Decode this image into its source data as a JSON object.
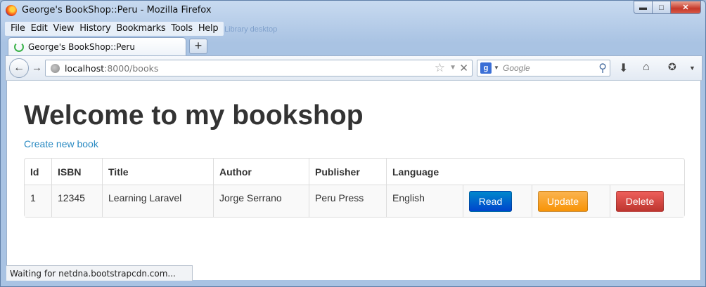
{
  "window": {
    "title": "George's BookShop::Peru - Mozilla Firefox"
  },
  "menu": [
    "File",
    "Edit",
    "View",
    "History",
    "Bookmarks",
    "Tools",
    "Help"
  ],
  "ghost_text": "Library desktop",
  "tab": {
    "label": "George's BookShop::Peru",
    "new_tab_label": "+"
  },
  "nav": {
    "url_host": "localhost",
    "url_rest": ":8000/books",
    "search_engine": "g",
    "search_placeholder": "Google"
  },
  "page": {
    "title": "Welcome to my bookshop",
    "create_link": "Create new book",
    "columns": [
      "Id",
      "ISBN",
      "Title",
      "Author",
      "Publisher",
      "Language"
    ],
    "rows": [
      {
        "id": "1",
        "isbn": "12345",
        "title": "Learning Laravel",
        "author": "Jorge Serrano",
        "publisher": "Peru Press",
        "language": "English"
      }
    ],
    "actions": {
      "read": "Read",
      "update": "Update",
      "delete": "Delete"
    }
  },
  "status": {
    "text": "Waiting for netdna.bootstrapcdn.com..."
  },
  "colors": {
    "link": "#2a8ac2",
    "read": "#0066cc",
    "update": "#f89406",
    "delete": "#bd362f"
  },
  "icons": [
    "firefox-logo",
    "minimize-icon",
    "maximize-icon",
    "close-icon",
    "loading-spinner-icon",
    "back-arrow-icon",
    "forward-arrow-icon",
    "globe-icon",
    "star-icon",
    "dropdown-icon",
    "stop-icon",
    "google-icon",
    "search-icon",
    "download-icon",
    "home-icon",
    "addon-icon",
    "menu-arrow-icon"
  ]
}
